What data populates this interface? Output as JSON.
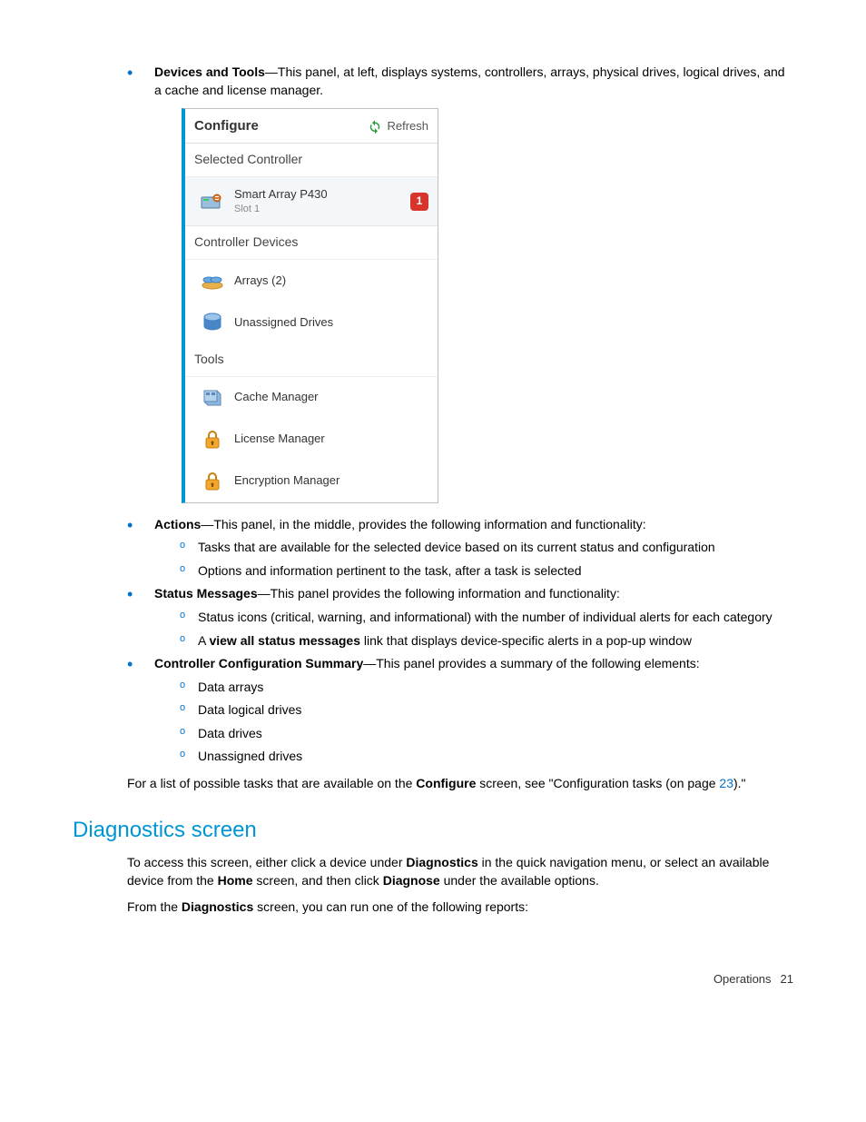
{
  "bullets": {
    "devices_tools_label": "Devices and Tools",
    "devices_tools_text": "—This panel, at left, displays systems, controllers, arrays, physical drives, logical drives, and a cache and license manager.",
    "actions_label": "Actions",
    "actions_text": "—This panel, in the middle, provides the following information and functionality:",
    "actions_sub": [
      "Tasks that are available for the selected device based on its current status and configuration",
      "Options and information pertinent to the task, after a task is selected"
    ],
    "status_label": "Status Messages",
    "status_text": "—This panel provides the following information and functionality:",
    "status_sub1": "Status icons (critical, warning, and informational) with the number of individual alerts for each category",
    "status_sub2_a": "A ",
    "status_sub2_bold": "view all status messages",
    "status_sub2_b": " link that displays device-specific alerts in a pop-up window",
    "ccs_label": "Controller Configuration Summary",
    "ccs_text": "—This panel provides a summary of the following elements:",
    "ccs_sub": [
      "Data arrays",
      "Data logical drives",
      "Data drives",
      "Unassigned drives"
    ]
  },
  "panel": {
    "title": "Configure",
    "refresh": "Refresh",
    "selected_controller": "Selected Controller",
    "controller_name": "Smart Array P430",
    "controller_slot": "Slot 1",
    "badge": "1",
    "controller_devices": "Controller Devices",
    "arrays": "Arrays (2)",
    "unassigned": "Unassigned Drives",
    "tools": "Tools",
    "cache_mgr": "Cache Manager",
    "license_mgr": "License Manager",
    "encryption_mgr": "Encryption Manager"
  },
  "closing": {
    "a": "For a list of possible tasks that are available on the ",
    "b": "Configure",
    "c": " screen, see \"Configuration tasks (on page ",
    "link": "23",
    "d": ").\""
  },
  "diag": {
    "heading": "Diagnostics screen",
    "p1_a": "To access this screen, either click a device under ",
    "p1_b": "Diagnostics",
    "p1_c": " in the quick navigation menu, or select an available device from the ",
    "p1_d": "Home",
    "p1_e": " screen, and then click ",
    "p1_f": "Diagnose",
    "p1_g": " under the available options.",
    "p2_a": "From the ",
    "p2_b": "Diagnostics",
    "p2_c": " screen, you can run one of the following reports:"
  },
  "footer": {
    "section": "Operations",
    "page": "21"
  }
}
